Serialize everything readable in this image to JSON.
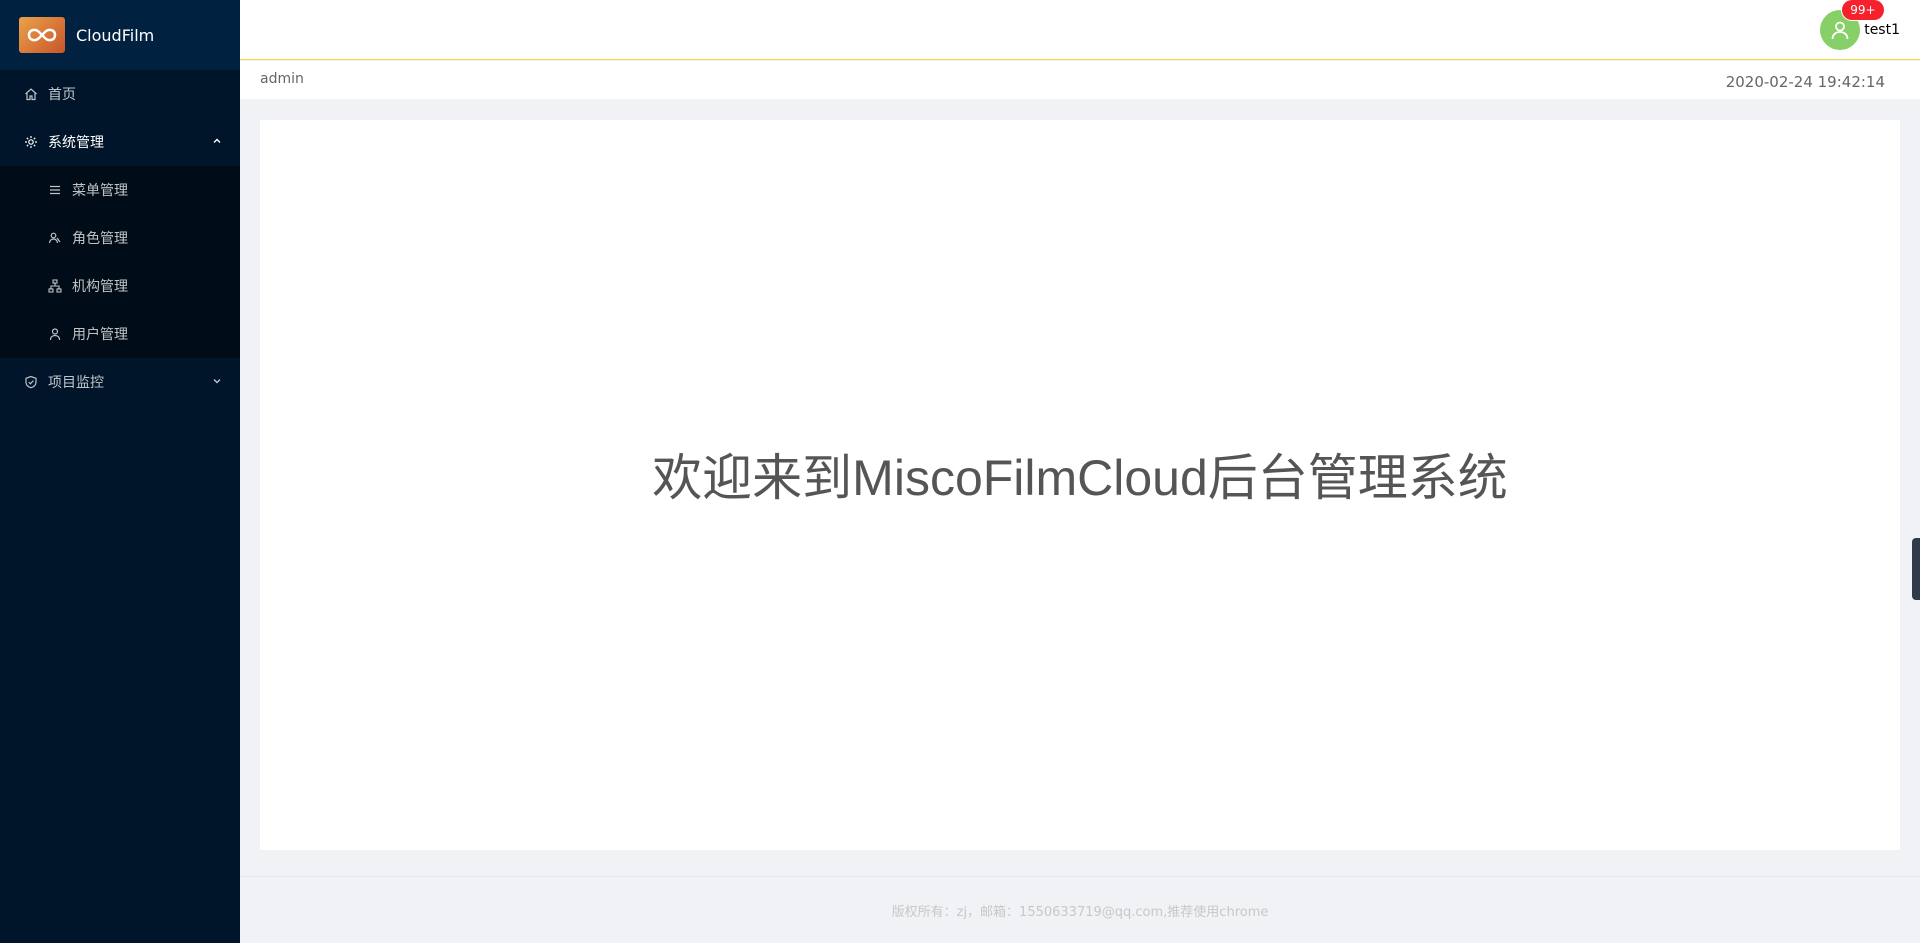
{
  "app": {
    "title": "CloudFilm"
  },
  "sidebar": {
    "items": [
      {
        "label": "首页",
        "icon": "home-icon"
      },
      {
        "label": "系统管理",
        "icon": "gear-icon",
        "expanded": true,
        "children": [
          {
            "label": "菜单管理",
            "icon": "menu-icon"
          },
          {
            "label": "角色管理",
            "icon": "role-icon"
          },
          {
            "label": "机构管理",
            "icon": "org-icon"
          },
          {
            "label": "用户管理",
            "icon": "user-icon"
          }
        ]
      },
      {
        "label": "项目监控",
        "icon": "shield-icon",
        "expanded": false
      }
    ]
  },
  "header": {
    "badge": "99+",
    "username": "test1"
  },
  "subheader": {
    "breadcrumb": "admin",
    "datetime": "2020-02-24 19:42:14"
  },
  "main": {
    "welcome": "欢迎来到MiscoFilmCloud后台管理系统"
  },
  "footer": {
    "text": "版权所有：zj，邮箱：1550633719@qq.com,推荐使用chrome"
  },
  "colors": {
    "sidebar_bg": "#001529",
    "submenu_bg": "#000c17",
    "avatar": "#87d068",
    "badge": "#f5222d"
  }
}
